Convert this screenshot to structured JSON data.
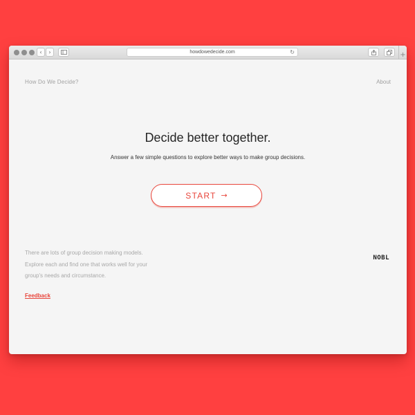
{
  "browser": {
    "url": "howdowedecide.com",
    "icons": {
      "back": "chevron-left-icon",
      "forward": "chevron-right-icon",
      "sidebar": "sidebar-icon",
      "reload": "reload-icon",
      "share": "share-icon",
      "tabs": "tabs-icon",
      "new_tab": "plus-icon"
    }
  },
  "nav": {
    "site_title": "How Do We Decide?",
    "about": "About"
  },
  "hero": {
    "headline": "Decide better together.",
    "subhead": "Answer a few simple questions to explore better ways to make group decisions.",
    "start_label": "START",
    "start_icon": "arrow-right-icon"
  },
  "footer": {
    "description_lines": [
      "There are lots of group decision making models.",
      "Explore each and find one that works well for your",
      "group's needs and circumstance."
    ],
    "feedback": "Feedback",
    "logo": "NOBL"
  },
  "colors": {
    "background": "#ff4040",
    "accent": "#e8443a",
    "page": "#f5f5f5"
  }
}
